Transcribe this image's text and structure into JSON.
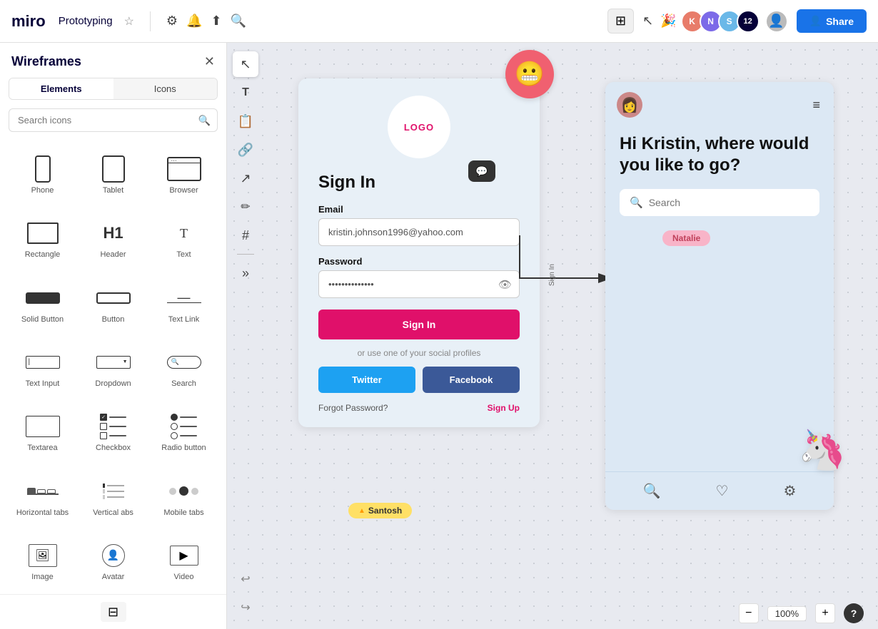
{
  "topbar": {
    "logo": "miro",
    "project_name": "Prototyping",
    "share_label": "Share",
    "zoom_level": "100%"
  },
  "sidebar": {
    "title": "Wireframes",
    "tabs": [
      {
        "label": "Elements",
        "active": true
      },
      {
        "label": "Icons",
        "active": false
      }
    ],
    "search_placeholder": "Search icons",
    "elements": [
      {
        "label": "Phone",
        "type": "phone"
      },
      {
        "label": "Tablet",
        "type": "tablet"
      },
      {
        "label": "Browser",
        "type": "browser"
      },
      {
        "label": "Rectangle",
        "type": "rect"
      },
      {
        "label": "Header",
        "type": "h1"
      },
      {
        "label": "Text",
        "type": "text"
      },
      {
        "label": "Solid Button",
        "type": "solid-btn"
      },
      {
        "label": "Button",
        "type": "btn"
      },
      {
        "label": "Text Link",
        "type": "text-link"
      },
      {
        "label": "Text Input",
        "type": "text-input"
      },
      {
        "label": "Dropdown",
        "type": "dropdown"
      },
      {
        "label": "Search",
        "type": "search"
      },
      {
        "label": "Textarea",
        "type": "textarea"
      },
      {
        "label": "Checkbox",
        "type": "checkbox"
      },
      {
        "label": "Radio button",
        "type": "radio"
      },
      {
        "label": "Horizontal tabs",
        "type": "horiz-tabs"
      },
      {
        "label": "Vertical abs",
        "type": "vert-tabs"
      },
      {
        "label": "Mobile tabs",
        "type": "mobile-tabs"
      },
      {
        "label": "Image",
        "type": "image"
      },
      {
        "label": "Avatar",
        "type": "avatar"
      },
      {
        "label": "Video",
        "type": "video"
      }
    ]
  },
  "signin_frame": {
    "logo_text": "LOGO",
    "title": "Sign In",
    "email_label": "Email",
    "email_value": "kristin.johnson1996@yahoo.com",
    "password_label": "Password",
    "password_value": "••••••••••••••",
    "signin_btn": "Sign In",
    "social_text": "or use one of your social profiles",
    "twitter_btn": "Twitter",
    "facebook_btn": "Facebook",
    "forgot_text": "Forgot Password?",
    "signup_text": "Sign Up"
  },
  "right_frame": {
    "greeting": "Hi Kristin, where would you like to go?",
    "search_placeholder": "Search",
    "natalie_badge": "Natalie"
  },
  "labels": {
    "sign_in_vertical": "Sign In",
    "santosh_badge": "Santosh"
  }
}
